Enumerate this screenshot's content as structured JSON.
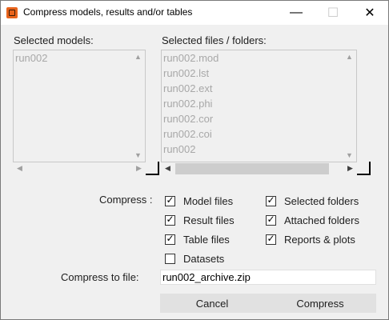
{
  "window": {
    "title": "Compress models, results and/or tables",
    "minimize_glyph": "—",
    "maximize_glyph": "☐",
    "close_glyph": "✕"
  },
  "models": {
    "label": "Selected models:",
    "items": [
      "run002"
    ]
  },
  "files": {
    "label": "Selected files / folders:",
    "items": [
      "run002.mod",
      "run002.lst",
      "run002.ext",
      "run002.phi",
      "run002.cor",
      "run002.coi",
      "run002"
    ]
  },
  "compress": {
    "label": "Compress :",
    "options": [
      {
        "label": "Model files",
        "checked": true
      },
      {
        "label": "Result files",
        "checked": true
      },
      {
        "label": "Table files",
        "checked": true
      },
      {
        "label": "Datasets",
        "checked": false
      },
      {
        "label": "Selected folders",
        "checked": true
      },
      {
        "label": "Attached folders",
        "checked": true
      },
      {
        "label": "Reports & plots",
        "checked": true
      }
    ]
  },
  "target": {
    "label": "Compress to  file:",
    "value": "run002_archive.zip"
  },
  "buttons": {
    "cancel": "Cancel",
    "compress": "Compress"
  },
  "icons": {
    "app": "app-logo-icon",
    "scroll_up": "chevron-up-icon",
    "scroll_down": "chevron-down-icon",
    "scroll_left": "chevron-left-icon",
    "scroll_right": "chevron-right-icon"
  },
  "colors": {
    "app_icon": "#e8641c",
    "dialog_bg": "#f0f0f0",
    "disabled_text": "#a8a8a8"
  }
}
